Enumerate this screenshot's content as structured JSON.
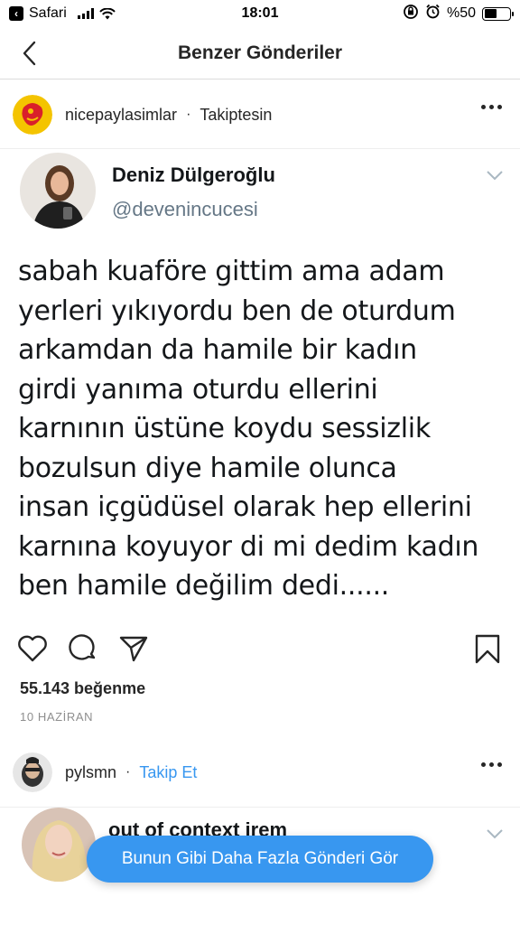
{
  "status_bar": {
    "carrier": "Safari",
    "time": "18:01",
    "battery_text": "%50",
    "battery_level": 0.5
  },
  "nav": {
    "title": "Benzer Gönderiler"
  },
  "post1": {
    "username": "nicepaylasimlar",
    "separator": "·",
    "follow_status": "Takiptesin",
    "tweet": {
      "name": "Deniz Dülgeroğlu",
      "handle": "@devenincucesi",
      "lines": [
        "sabah kuaföre gittim ama adam",
        "yerleri yıkıyordu ben de oturdum",
        "arkamdan da hamile bir kadın",
        "girdi yanıma oturdu ellerini",
        "karnının üstüne koydu sessizlik",
        "bozulsun diye hamile olunca",
        "insan içgüdüsel olarak hep ellerini",
        "karnına koyuyor di mi dedim kadın",
        "ben hamile değilim dedi......"
      ]
    },
    "likes": "55.143 beğenme",
    "date": "10 HAZİRAN"
  },
  "post2": {
    "username": "pylsmn",
    "separator": "·",
    "follow_action": "Takip Et",
    "tweet": {
      "name": "out of context irem"
    }
  },
  "floating_button": {
    "label": "Bunun Gibi Daha Fazla Gönderi Gör"
  },
  "colors": {
    "accent": "#3897f0",
    "text": "#262626",
    "muted": "#8e8e8e",
    "twitter_text": "#14171a",
    "twitter_handle": "#657786"
  }
}
